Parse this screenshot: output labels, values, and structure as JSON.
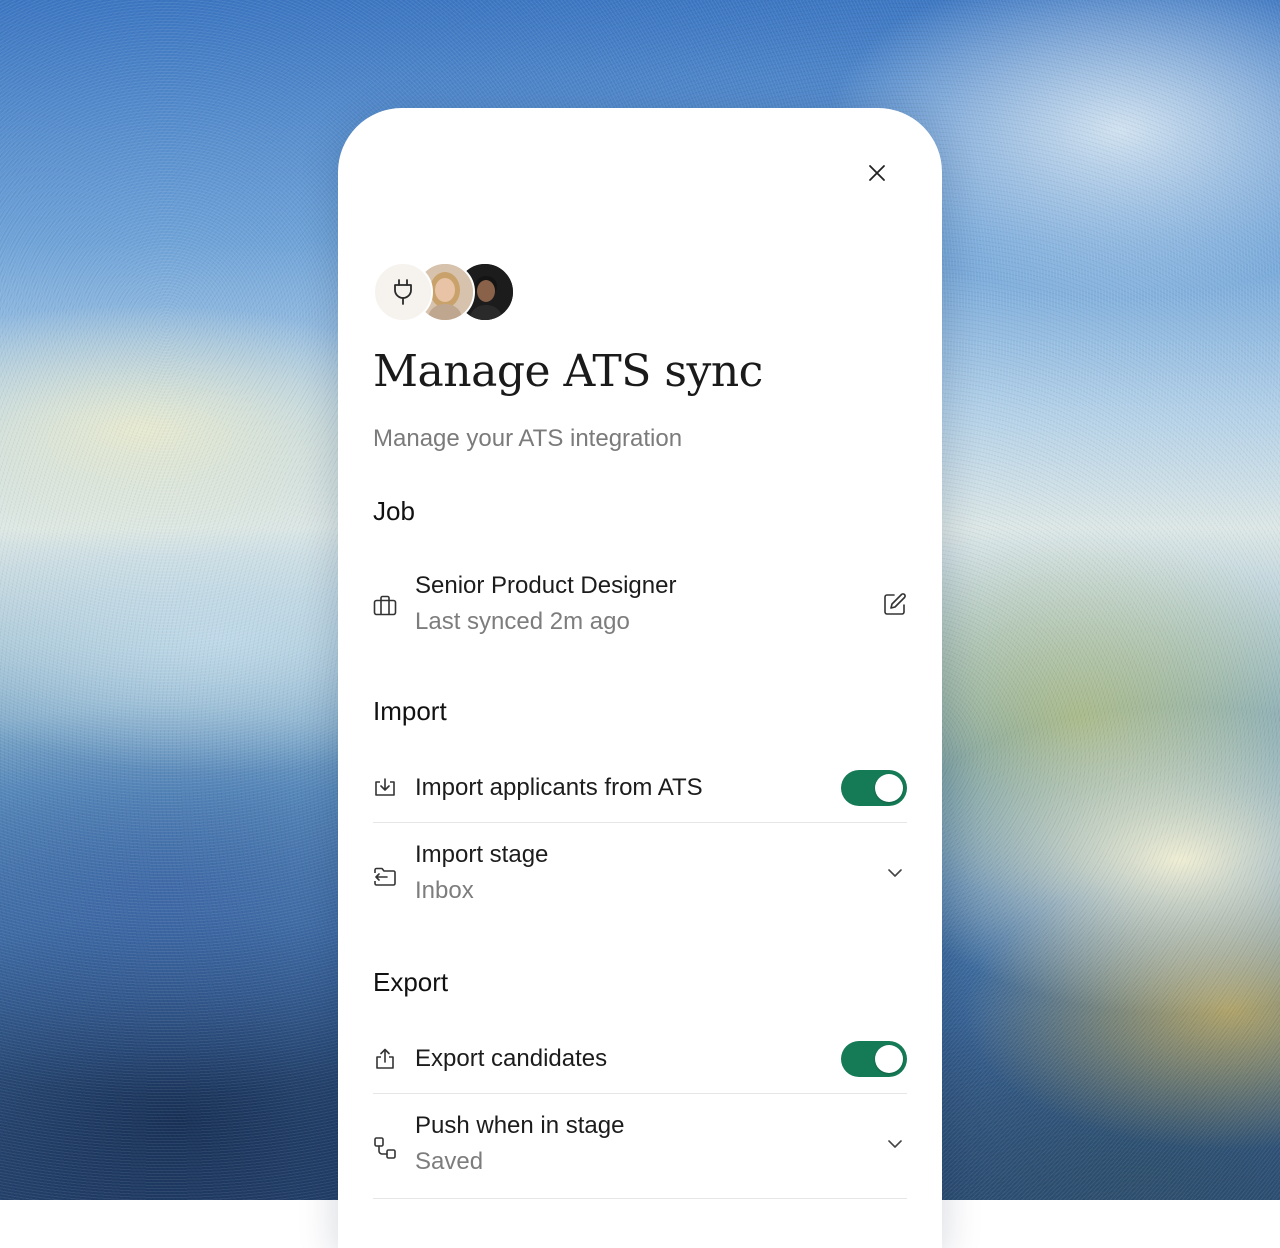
{
  "modal": {
    "title": "Manage ATS sync",
    "subtitle": "Manage your ATS integration"
  },
  "icons": {
    "close": "close-icon",
    "plug": "plug-icon",
    "briefcase": "briefcase-icon",
    "edit": "edit-icon",
    "import": "import-icon",
    "folder": "folder-move-icon",
    "export": "export-icon",
    "workflow": "workflow-icon",
    "chevron": "chevron-down-icon"
  },
  "job": {
    "heading": "Job",
    "name": "Senior Product Designer",
    "status": "Last synced 2m ago"
  },
  "import": {
    "heading": "Import",
    "applicants_label": "Import applicants from ATS",
    "applicants_enabled": true,
    "stage_label": "Import stage",
    "stage_value": "Inbox"
  },
  "export": {
    "heading": "Export",
    "candidates_label": "Export candidates",
    "candidates_enabled": true,
    "push_label": "Push when in stage",
    "push_value": "Saved"
  },
  "colors": {
    "toggle_on": "#157a56",
    "title": "#1a1a1a",
    "muted": "#7b7b7b"
  }
}
